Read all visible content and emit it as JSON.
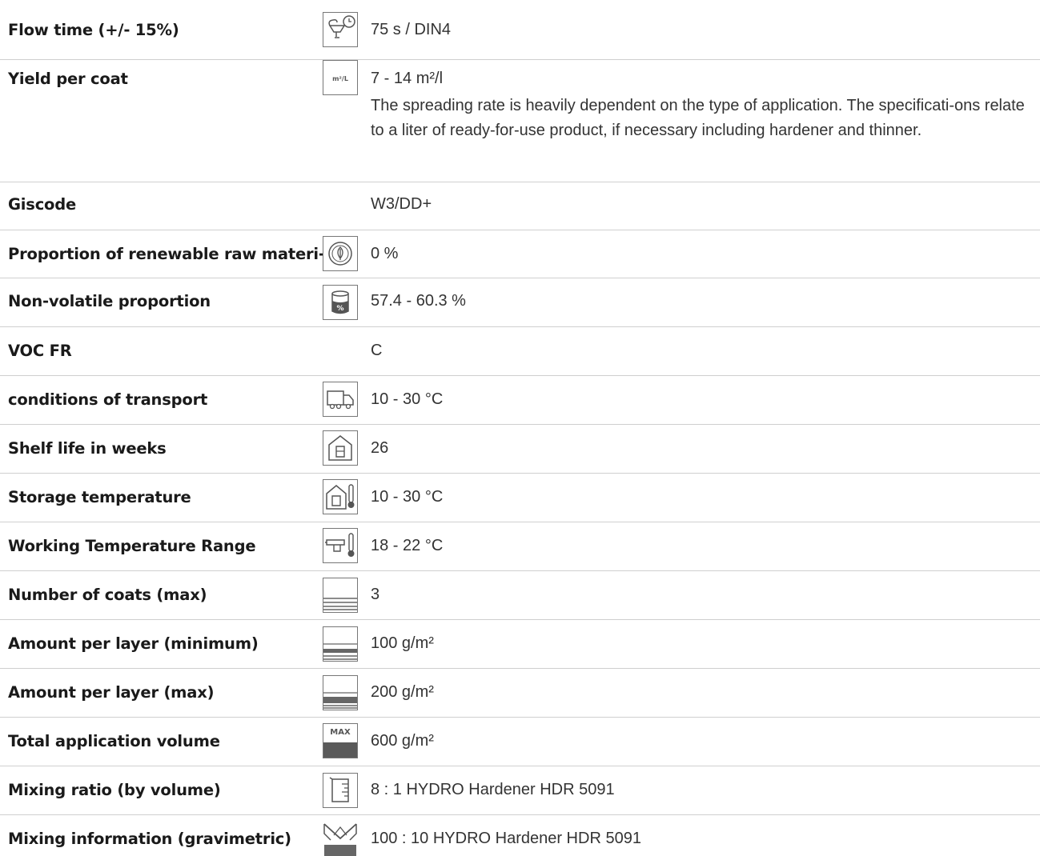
{
  "rows": [
    {
      "label": "Flow time (+/- 15%)",
      "icon": "flow-cup-timer-icon",
      "value": "75 s / DIN4"
    },
    {
      "label": "Yield per coat",
      "icon": "square-meters-per-liter-icon",
      "icon_text": "m²/L",
      "value": "7 - 14 m²/l",
      "note": "The spreading rate is heavily dependent on the type of application. The specificati-ons relate to a liter of ready-for-use product, if necessary including hardener and thinner."
    },
    {
      "label": "Giscode",
      "icon": "",
      "value": "W3/DD+"
    },
    {
      "label": "Proportion of renewable raw materi-",
      "icon": "leaf-cycle-icon",
      "value": "0 %"
    },
    {
      "label": "Non-volatile proportion",
      "icon": "can-percent-icon",
      "value": "57.4 - 60.3 %"
    },
    {
      "label": "VOC FR",
      "icon": "",
      "value": "C"
    },
    {
      "label": "conditions of transport",
      "icon": "truck-icon",
      "value": "10 - 30 °C"
    },
    {
      "label": "Shelf life in weeks",
      "icon": "storage-house-icon",
      "value": "26"
    },
    {
      "label": "Storage temperature",
      "icon": "storage-thermometer-icon",
      "value": "10 - 30 °C"
    },
    {
      "label": "Working Temperature Range",
      "icon": "spray-gun-thermometer-icon",
      "value": "18 - 22 °C"
    },
    {
      "label": "Number of coats (max)",
      "icon": "coat-layers-icon",
      "value": "3"
    },
    {
      "label": "Amount per layer (minimum)",
      "icon": "layer-amount-min-icon",
      "value": "100 g/m²"
    },
    {
      "label": "Amount per layer (max)",
      "icon": "layer-amount-max-icon",
      "value": "200 g/m²"
    },
    {
      "label": "Total application volume",
      "icon": "total-volume-max-icon",
      "icon_text": "MAX",
      "value": "600 g/m²"
    },
    {
      "label": "Mixing ratio (by volume)",
      "icon": "measuring-beaker-icon",
      "value": "8 : 1 HYDRO Hardener HDR 5091"
    },
    {
      "label": "Mixing information (gravimetric)",
      "icon": "scale-weight-icon",
      "value": "100 : 10 HYDRO Hardener HDR 5091"
    }
  ],
  "colors": {
    "divider": "#cfcfcf",
    "label": "#1a1a1a",
    "value": "#333333",
    "icon_stroke": "#555555"
  }
}
